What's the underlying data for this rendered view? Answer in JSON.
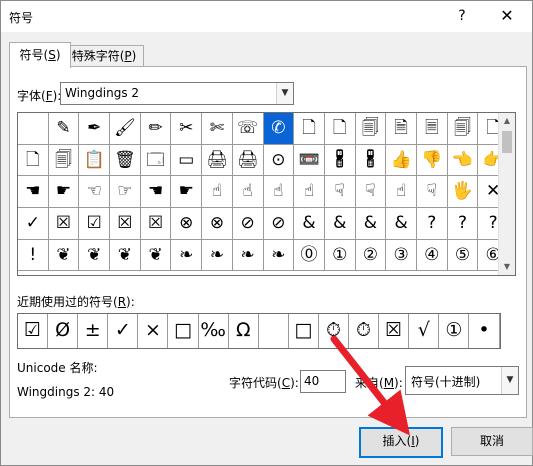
{
  "dialog": {
    "title": "符号",
    "help_glyph": "?",
    "close_glyph": "✕"
  },
  "tabs": {
    "symbols": {
      "label": "符号(",
      "key": "S",
      "suffix": ")"
    },
    "special": {
      "label": "特殊字符(",
      "key": "P",
      "suffix": ")"
    }
  },
  "font": {
    "label": "字体(",
    "key": "F",
    "suffix": "):",
    "value": "Wingdings 2"
  },
  "grid": {
    "selected_index": 8,
    "symbols": [
      "",
      "✎",
      "✒",
      "🖌",
      "✏",
      "✂",
      "✄",
      "☏",
      "✆",
      "🗋",
      "🗋",
      "🗐",
      "🗎",
      "🗏",
      "🗐",
      "🗋",
      "🗋",
      "🗐",
      "📋",
      "🗑",
      "🗔",
      "▭",
      "🖨",
      "🖨",
      "⊙",
      "📼",
      "🖁",
      "🖁",
      "👍",
      "👎",
      "👈",
      "👉",
      "☚",
      "☛",
      "☜",
      "☞",
      "☚",
      "☛",
      "☝",
      "☝",
      "☝",
      "☝",
      "☟",
      "☟",
      "☝",
      "☟",
      "🖐",
      "✕",
      "✓",
      "☒",
      "☑",
      "☒",
      "☒",
      "⊗",
      "⊗",
      "⊘",
      "⊘",
      "&",
      "&",
      "&",
      "&",
      "?",
      "?",
      "?",
      "!",
      "❦",
      "❦",
      "❦",
      "❦",
      "❧",
      "❧",
      "❧",
      "❧",
      "⓪",
      "①",
      "②",
      "③",
      "④",
      "⑤",
      "⑥"
    ]
  },
  "recent": {
    "label": "近期使用过的符号(",
    "key": "R",
    "suffix": "):",
    "symbols": [
      "☑",
      "Ø",
      "±",
      "✓",
      "×",
      "□",
      "‰",
      "Ω",
      "",
      "□",
      "⏱",
      "⏱",
      "☒",
      "√",
      "①",
      "•"
    ]
  },
  "unicode": {
    "name_label": "Unicode 名称:",
    "name_value": "Wingdings 2: 40"
  },
  "char_code": {
    "label": "字符代码(",
    "key": "C",
    "suffix": "):",
    "value": "40"
  },
  "from": {
    "label": "来自(",
    "key": "M",
    "suffix": "):",
    "value": "符号(十进制)"
  },
  "buttons": {
    "insert": {
      "label": "插入(",
      "key": "I",
      "suffix": ")"
    },
    "cancel": "取消"
  },
  "colors": {
    "selection": "#0a64d6",
    "focus_border": "#0078d7",
    "annotation_arrow": "#e8202a"
  }
}
